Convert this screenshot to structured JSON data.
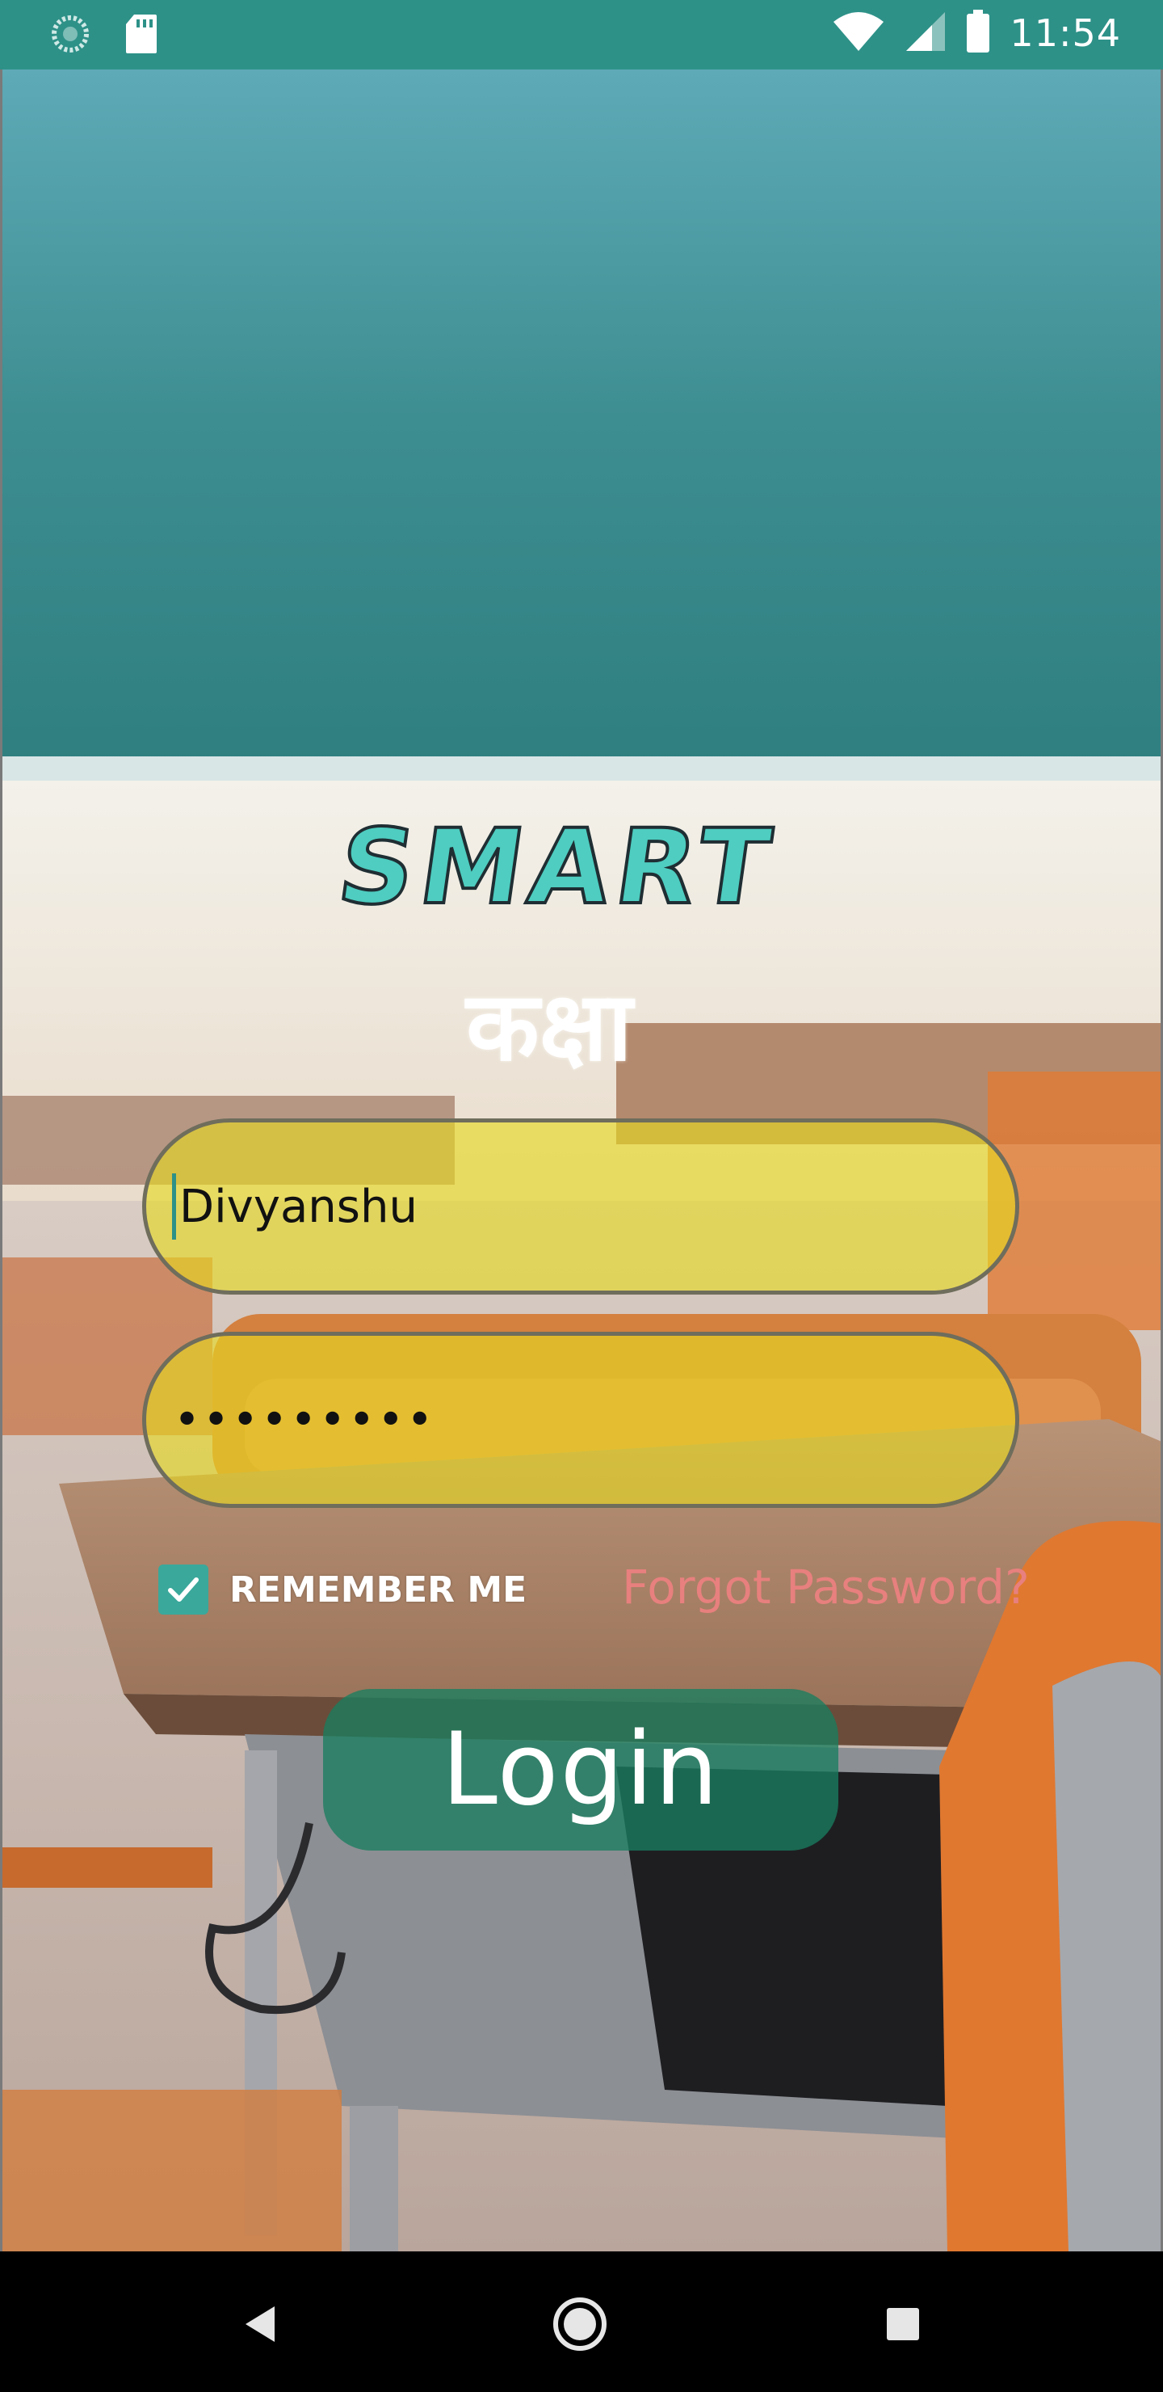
{
  "status_bar": {
    "time": "11:54",
    "left_icons": [
      "sync-icon",
      "sd-card-icon"
    ],
    "right_icons": [
      "wifi-icon",
      "cell-signal-icon",
      "battery-icon"
    ],
    "background": "#2e9188"
  },
  "logo": {
    "line1": "SMART",
    "line2": "कक्षा"
  },
  "form": {
    "username_value": "Divyanshu",
    "password_mask": "•••••••••",
    "remember_label": "REMEMBER ME",
    "remember_checked": true,
    "forgot_label": "Forgot Password?",
    "login_label": "Login"
  },
  "colors": {
    "accent": "#3aa89b",
    "field_fill": "#e6da1e",
    "forgot": "#e7807e",
    "login_button": "#1a7d5f"
  },
  "nav_bar": {
    "buttons": [
      "back-icon",
      "home-icon",
      "recents-icon"
    ]
  }
}
